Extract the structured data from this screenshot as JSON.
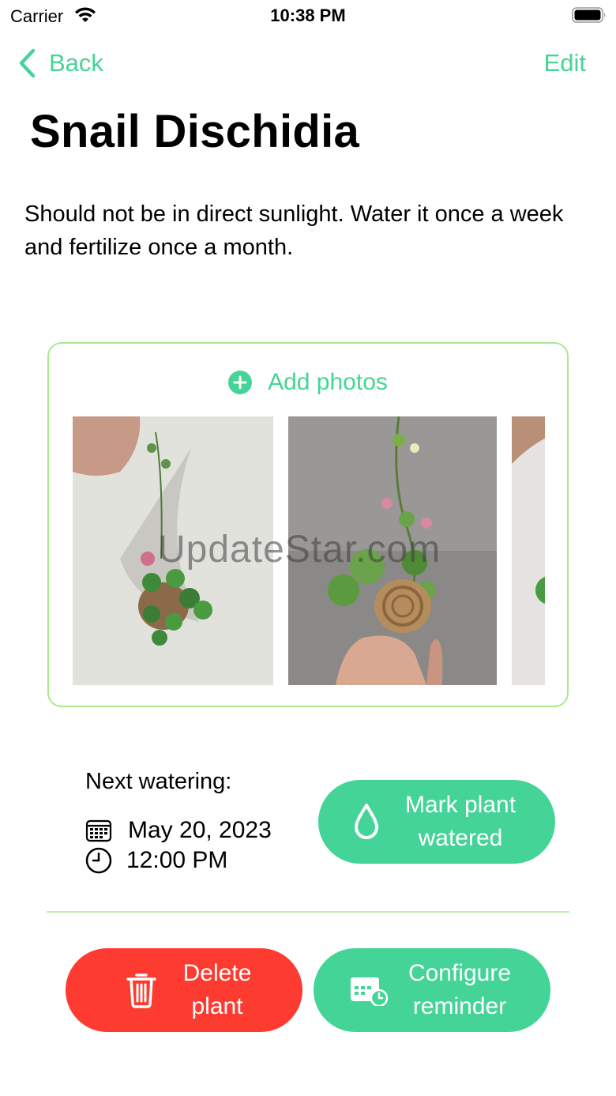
{
  "status_bar": {
    "carrier": "Carrier",
    "time": "10:38 PM",
    "wifi_icon": "wifi-icon",
    "battery_icon": "battery-icon"
  },
  "nav": {
    "back_label": "Back",
    "edit_label": "Edit"
  },
  "plant": {
    "name": "Snail Dischidia",
    "description": "Should not be in direct sunlight. Water it once a week and fertilize once a month."
  },
  "photos": {
    "add_label": "Add photos",
    "items": [
      {
        "name": "plant-photo-1"
      },
      {
        "name": "plant-photo-2"
      },
      {
        "name": "plant-photo-3"
      }
    ]
  },
  "watermark": "UpdateStar.com",
  "watering": {
    "label": "Next watering:",
    "date": "May 20, 2023",
    "time": "12:00 PM",
    "mark_button_label": "Mark plant watered"
  },
  "actions": {
    "delete_label": "Delete plant",
    "configure_label": "Configure reminder"
  },
  "colors": {
    "accent": "#45d497",
    "destructive": "#fd3b30",
    "card_border": "#a8e88f"
  }
}
